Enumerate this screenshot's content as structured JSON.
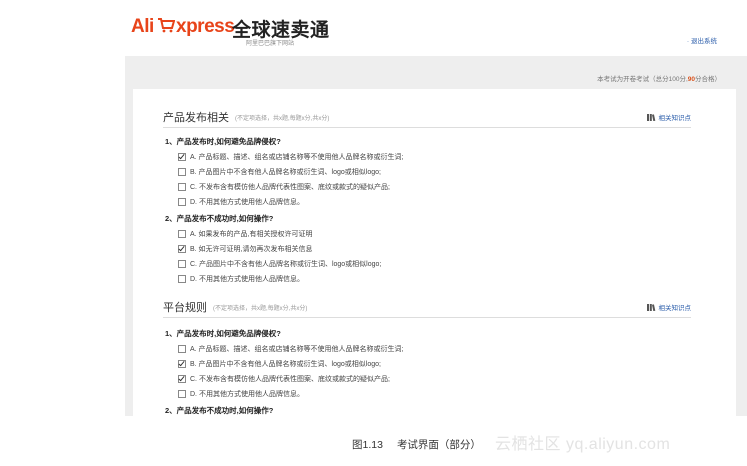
{
  "header": {
    "logo_ali": "Ali",
    "logo_xpress": "xpress",
    "logo_cn_name": "全球速卖通",
    "logo_sub": "阿里巴巴旗下网站",
    "logout_label": "退出系统"
  },
  "exam_info": {
    "prefix": "本考试为开卷考试（总分100分,",
    "score": "90",
    "suffix": "分合格）"
  },
  "sections": [
    {
      "title": "产品发布相关",
      "note": "(不定项选择，共x题,每题x分,共x分)",
      "knowledge_link": "相关知识点",
      "questions": [
        {
          "text": "1、产品发布时,如何避免品牌侵权?",
          "options": [
            {
              "label": "A. 产品标题、描述、组名或店铺名称等不使用他人品牌名称或衍生词;",
              "checked": true
            },
            {
              "label": "B. 产品图片中不含有他人品牌名称或衍生词、logo或相似logo;",
              "checked": false
            },
            {
              "label": "C. 不发布含有模仿他人品牌代表性图案、底纹或款式的疑似产品;",
              "checked": false
            },
            {
              "label": "D. 不用其他方式使用他人品牌信息。",
              "checked": false
            }
          ]
        },
        {
          "text": "2、产品发布不成功时,如何操作?",
          "options": [
            {
              "label": "A. 如果发布的产品,有相关授权许可证明",
              "checked": false
            },
            {
              "label": "B. 如无许可证明,请勿再次发布相关信息",
              "checked": true
            },
            {
              "label": "C. 产品图片中不含有他人品牌名称或衍生词、logo或相似logo;",
              "checked": false
            },
            {
              "label": "D. 不用其他方式使用他人品牌信息。",
              "checked": false
            }
          ]
        }
      ]
    },
    {
      "title": "平台规则",
      "note": "(不定项选择，共x题,每题x分,共x分)",
      "knowledge_link": "相关知识点",
      "questions": [
        {
          "text": "1、产品发布时,如何避免品牌侵权?",
          "options": [
            {
              "label": "A. 产品标题、描述、组名或店铺名称等不使用他人品牌名称或衍生词;",
              "checked": false
            },
            {
              "label": "B. 产品图片中不含有他人品牌名称或衍生词、logo或相似logo;",
              "checked": true
            },
            {
              "label": "C. 不发布含有模仿他人品牌代表性图案、底纹或款式的疑似产品;",
              "checked": true
            },
            {
              "label": "D. 不用其他方式使用他人品牌信息。",
              "checked": false
            }
          ]
        },
        {
          "text": "2、产品发布不成功时,如何操作?",
          "options": []
        }
      ]
    }
  ],
  "caption": {
    "figure_number": "图1.13",
    "text": "考试界面（部分）"
  },
  "watermark": "云栖社区 yq.aliyun.com",
  "colors": {
    "brand_orange": "#e8441a",
    "link_blue": "#2a5caa",
    "score_red": "#d9531e",
    "panel_grey": "#eeeeee"
  }
}
